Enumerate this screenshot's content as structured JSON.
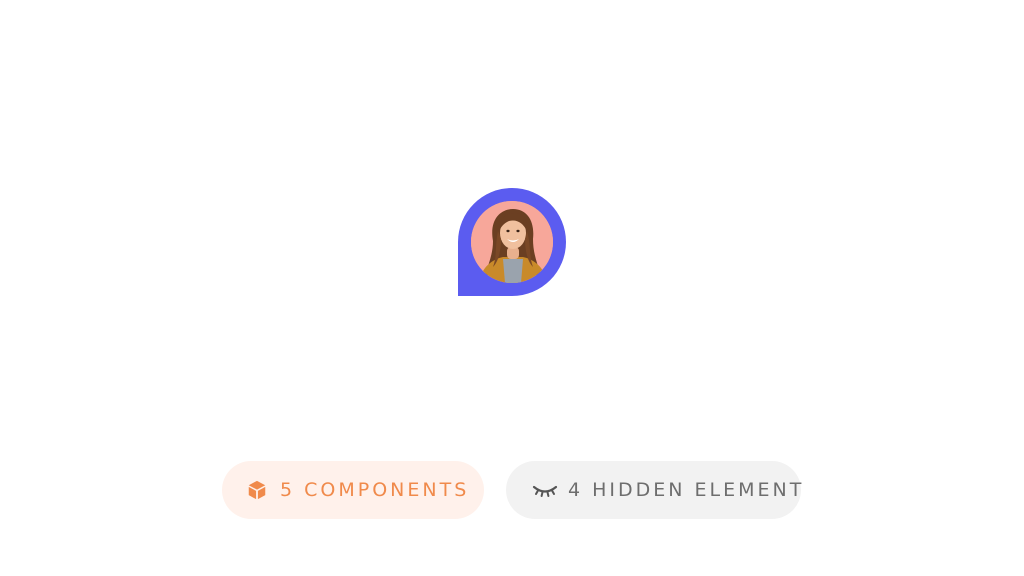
{
  "marker": {
    "accent_color": "#5b5cf0",
    "avatar_background": "#f7a79a"
  },
  "badges": {
    "components": {
      "icon": "cube-icon",
      "label": "5 COMPONENTS",
      "color": "#f08a4b",
      "background": "#fff1eb"
    },
    "hidden": {
      "icon": "eye-closed-icon",
      "label": "4 HIDDEN ELEMENT",
      "color": "#6e6e6e",
      "background": "#f2f2f2"
    }
  }
}
